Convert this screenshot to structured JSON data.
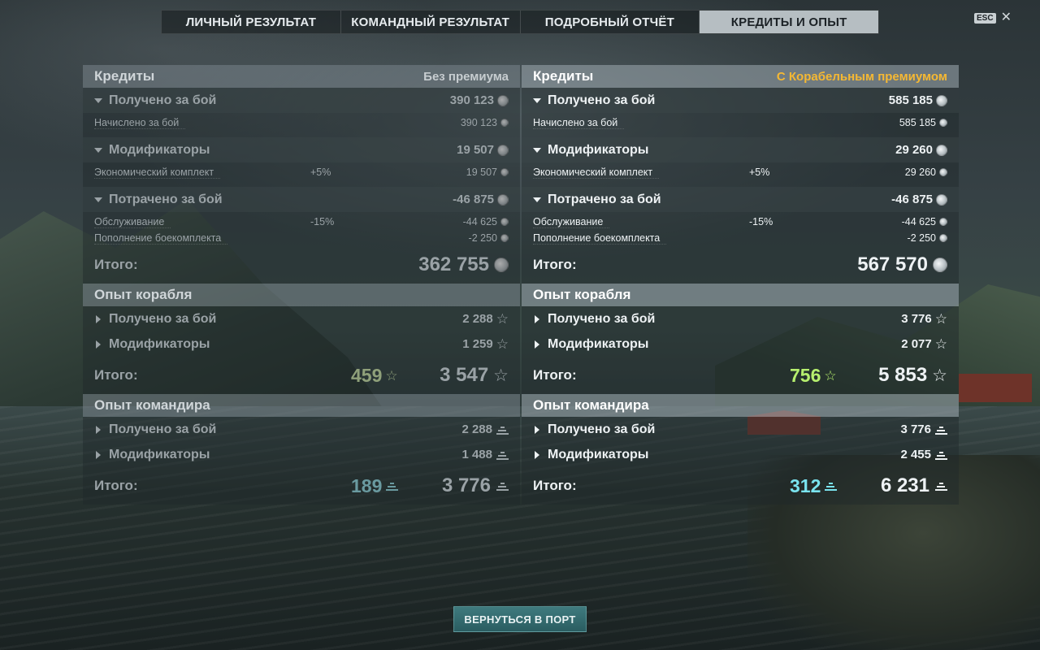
{
  "tabs": [
    {
      "label": "ЛИЧНЫЙ РЕЗУЛЬТАТ"
    },
    {
      "label": "КОМАНДНЫЙ РЕЗУЛЬТАТ"
    },
    {
      "label": "ПОДРОБНЫЙ ОТЧЁТ"
    },
    {
      "label": "КРЕДИТЫ И ОПЫТ",
      "active": true
    }
  ],
  "esc": {
    "badge": "ESC",
    "close": "✕"
  },
  "left": {
    "credits": {
      "title": "Кредиты",
      "subtitle": "Без премиума",
      "earned": {
        "label": "Получено за бой",
        "value": "390 123"
      },
      "earned_detail": {
        "label": "Начислено за бой",
        "value": "390 123"
      },
      "modifiers": {
        "label": "Модификаторы",
        "value": "19 507"
      },
      "economic": {
        "label": "Экономический комплект",
        "pct": "+5%",
        "value": "19 507"
      },
      "spent": {
        "label": "Потрачено за бой",
        "value": "-46 875"
      },
      "service": {
        "label": "Обслуживание",
        "pct": "-15%",
        "value": "-44 625"
      },
      "ammo": {
        "label": "Пополнение боекомплекта",
        "value": "-2 250"
      },
      "total": {
        "label": "Итого:",
        "value": "362 755"
      }
    },
    "ship_xp": {
      "title": "Опыт корабля",
      "earned": {
        "label": "Получено за бой",
        "value": "2 288"
      },
      "modifiers": {
        "label": "Модификаторы",
        "value": "1 259"
      },
      "total": {
        "label": "Итого:",
        "free": "459",
        "value": "3 547"
      }
    },
    "cmdr_xp": {
      "title": "Опыт командира",
      "earned": {
        "label": "Получено за бой",
        "value": "2 288"
      },
      "modifiers": {
        "label": "Модификаторы",
        "value": "1 488"
      },
      "total": {
        "label": "Итого:",
        "elite": "189",
        "value": "3 776"
      }
    }
  },
  "right": {
    "credits": {
      "title": "Кредиты",
      "subtitle": "С Корабельным премиумом",
      "earned": {
        "label": "Получено за бой",
        "value": "585 185"
      },
      "earned_detail": {
        "label": "Начислено за бой",
        "value": "585 185"
      },
      "modifiers": {
        "label": "Модификаторы",
        "value": "29 260"
      },
      "economic": {
        "label": "Экономический комплект",
        "pct": "+5%",
        "value": "29 260"
      },
      "spent": {
        "label": "Потрачено за бой",
        "value": "-46 875"
      },
      "service": {
        "label": "Обслуживание",
        "pct": "-15%",
        "value": "-44 625"
      },
      "ammo": {
        "label": "Пополнение боекомплекта",
        "value": "-2 250"
      },
      "total": {
        "label": "Итого:",
        "value": "567 570"
      }
    },
    "ship_xp": {
      "title": "Опыт корабля",
      "earned": {
        "label": "Получено за бой",
        "value": "3 776"
      },
      "modifiers": {
        "label": "Модификаторы",
        "value": "2 077"
      },
      "total": {
        "label": "Итого:",
        "free": "756",
        "value": "5 853"
      }
    },
    "cmdr_xp": {
      "title": "Опыт командира",
      "earned": {
        "label": "Получено за бой",
        "value": "3 776"
      },
      "modifiers": {
        "label": "Модификаторы",
        "value": "2 455"
      },
      "total": {
        "label": "Итого:",
        "elite": "312",
        "value": "6 231"
      }
    }
  },
  "back_button": {
    "label": "ВЕРНУТЬСЯ В ПОРТ"
  },
  "colors": {
    "premium_accent": "#f5b833",
    "free_xp": "#b6ef6e",
    "elite_xp": "#7ae3ee",
    "back_button": "#2f6a6e"
  }
}
